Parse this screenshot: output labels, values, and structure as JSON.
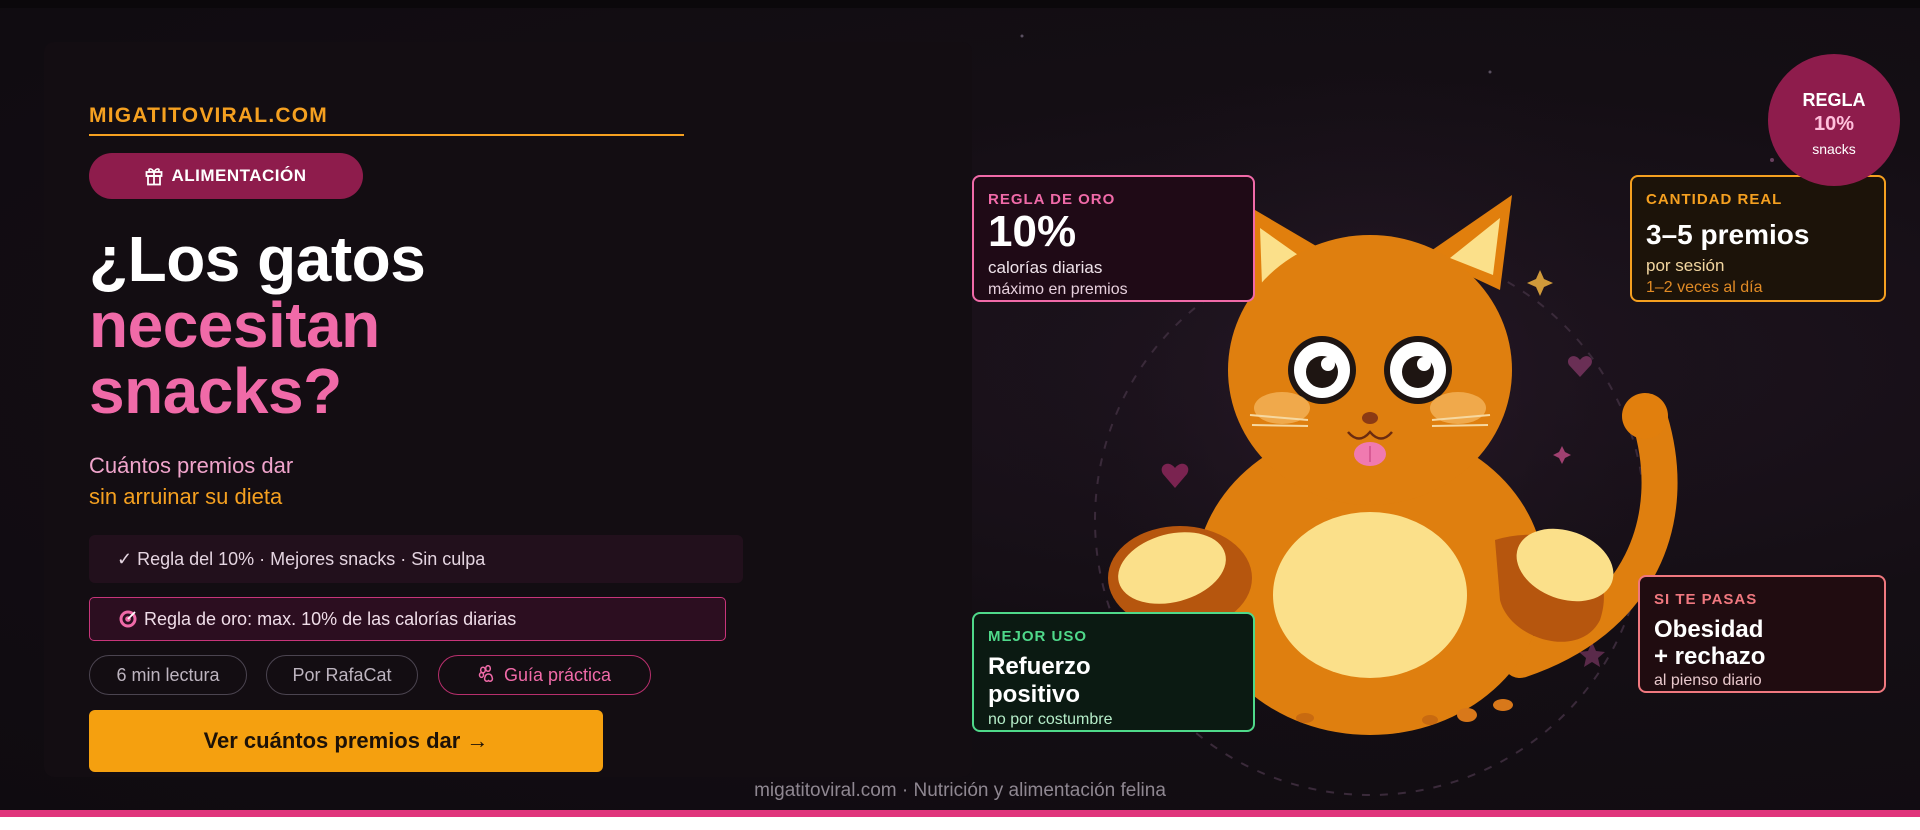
{
  "brand": {
    "name": "MIGATITOVIRAL.COM"
  },
  "category": {
    "label": "ALIMENTACIÓN",
    "icon": "gift-icon"
  },
  "headline": {
    "line1": "¿Los gatos",
    "line2": "necesitan",
    "line3": "snacks?"
  },
  "subtitle": {
    "line1": "Cuántos premios dar",
    "line2": "sin arruinar su dieta"
  },
  "features": "✓ Regla del 10% · Mejores snacks · Sin culpa",
  "rule": {
    "icon": "target-icon",
    "text": "Regla de oro: max. 10% de las calorías diarias"
  },
  "tags": {
    "read_time": "6 min lectura",
    "author": "Por RafaCat",
    "guide": "Guía práctica",
    "guide_icon": "paw-icon"
  },
  "cta": {
    "label": "Ver cuántos premios dar →"
  },
  "footer": "migatitoviral.com · Nutrición y alimentación felina",
  "cards": {
    "gold_rule": {
      "label": "REGLA DE ORO",
      "value": "10%",
      "line1": "calorías diarias",
      "line2": "máximo en premios"
    },
    "real_amount": {
      "label": "CANTIDAD REAL",
      "value": "3–5 premios",
      "line1": "por sesión",
      "line2": "1–2 veces al día"
    },
    "best_use": {
      "label": "MEJOR USO",
      "value_line1": "Refuerzo",
      "value_line2": "positivo",
      "line1": "no por costumbre"
    },
    "overdo": {
      "label": "SI TE PASAS",
      "value_line1": "Obesidad",
      "value_line2": "+ rechazo",
      "line1": "al pienso diario"
    }
  },
  "badge": {
    "line1": "REGLA",
    "line2": "10%",
    "line3": "snacks"
  },
  "colors": {
    "accent_orange": "#f5a020",
    "accent_pink": "#f06aa8",
    "brand_magenta": "#8e1c4c",
    "green": "#4fd98a",
    "coral": "#f0787f",
    "background": "#140e14"
  }
}
